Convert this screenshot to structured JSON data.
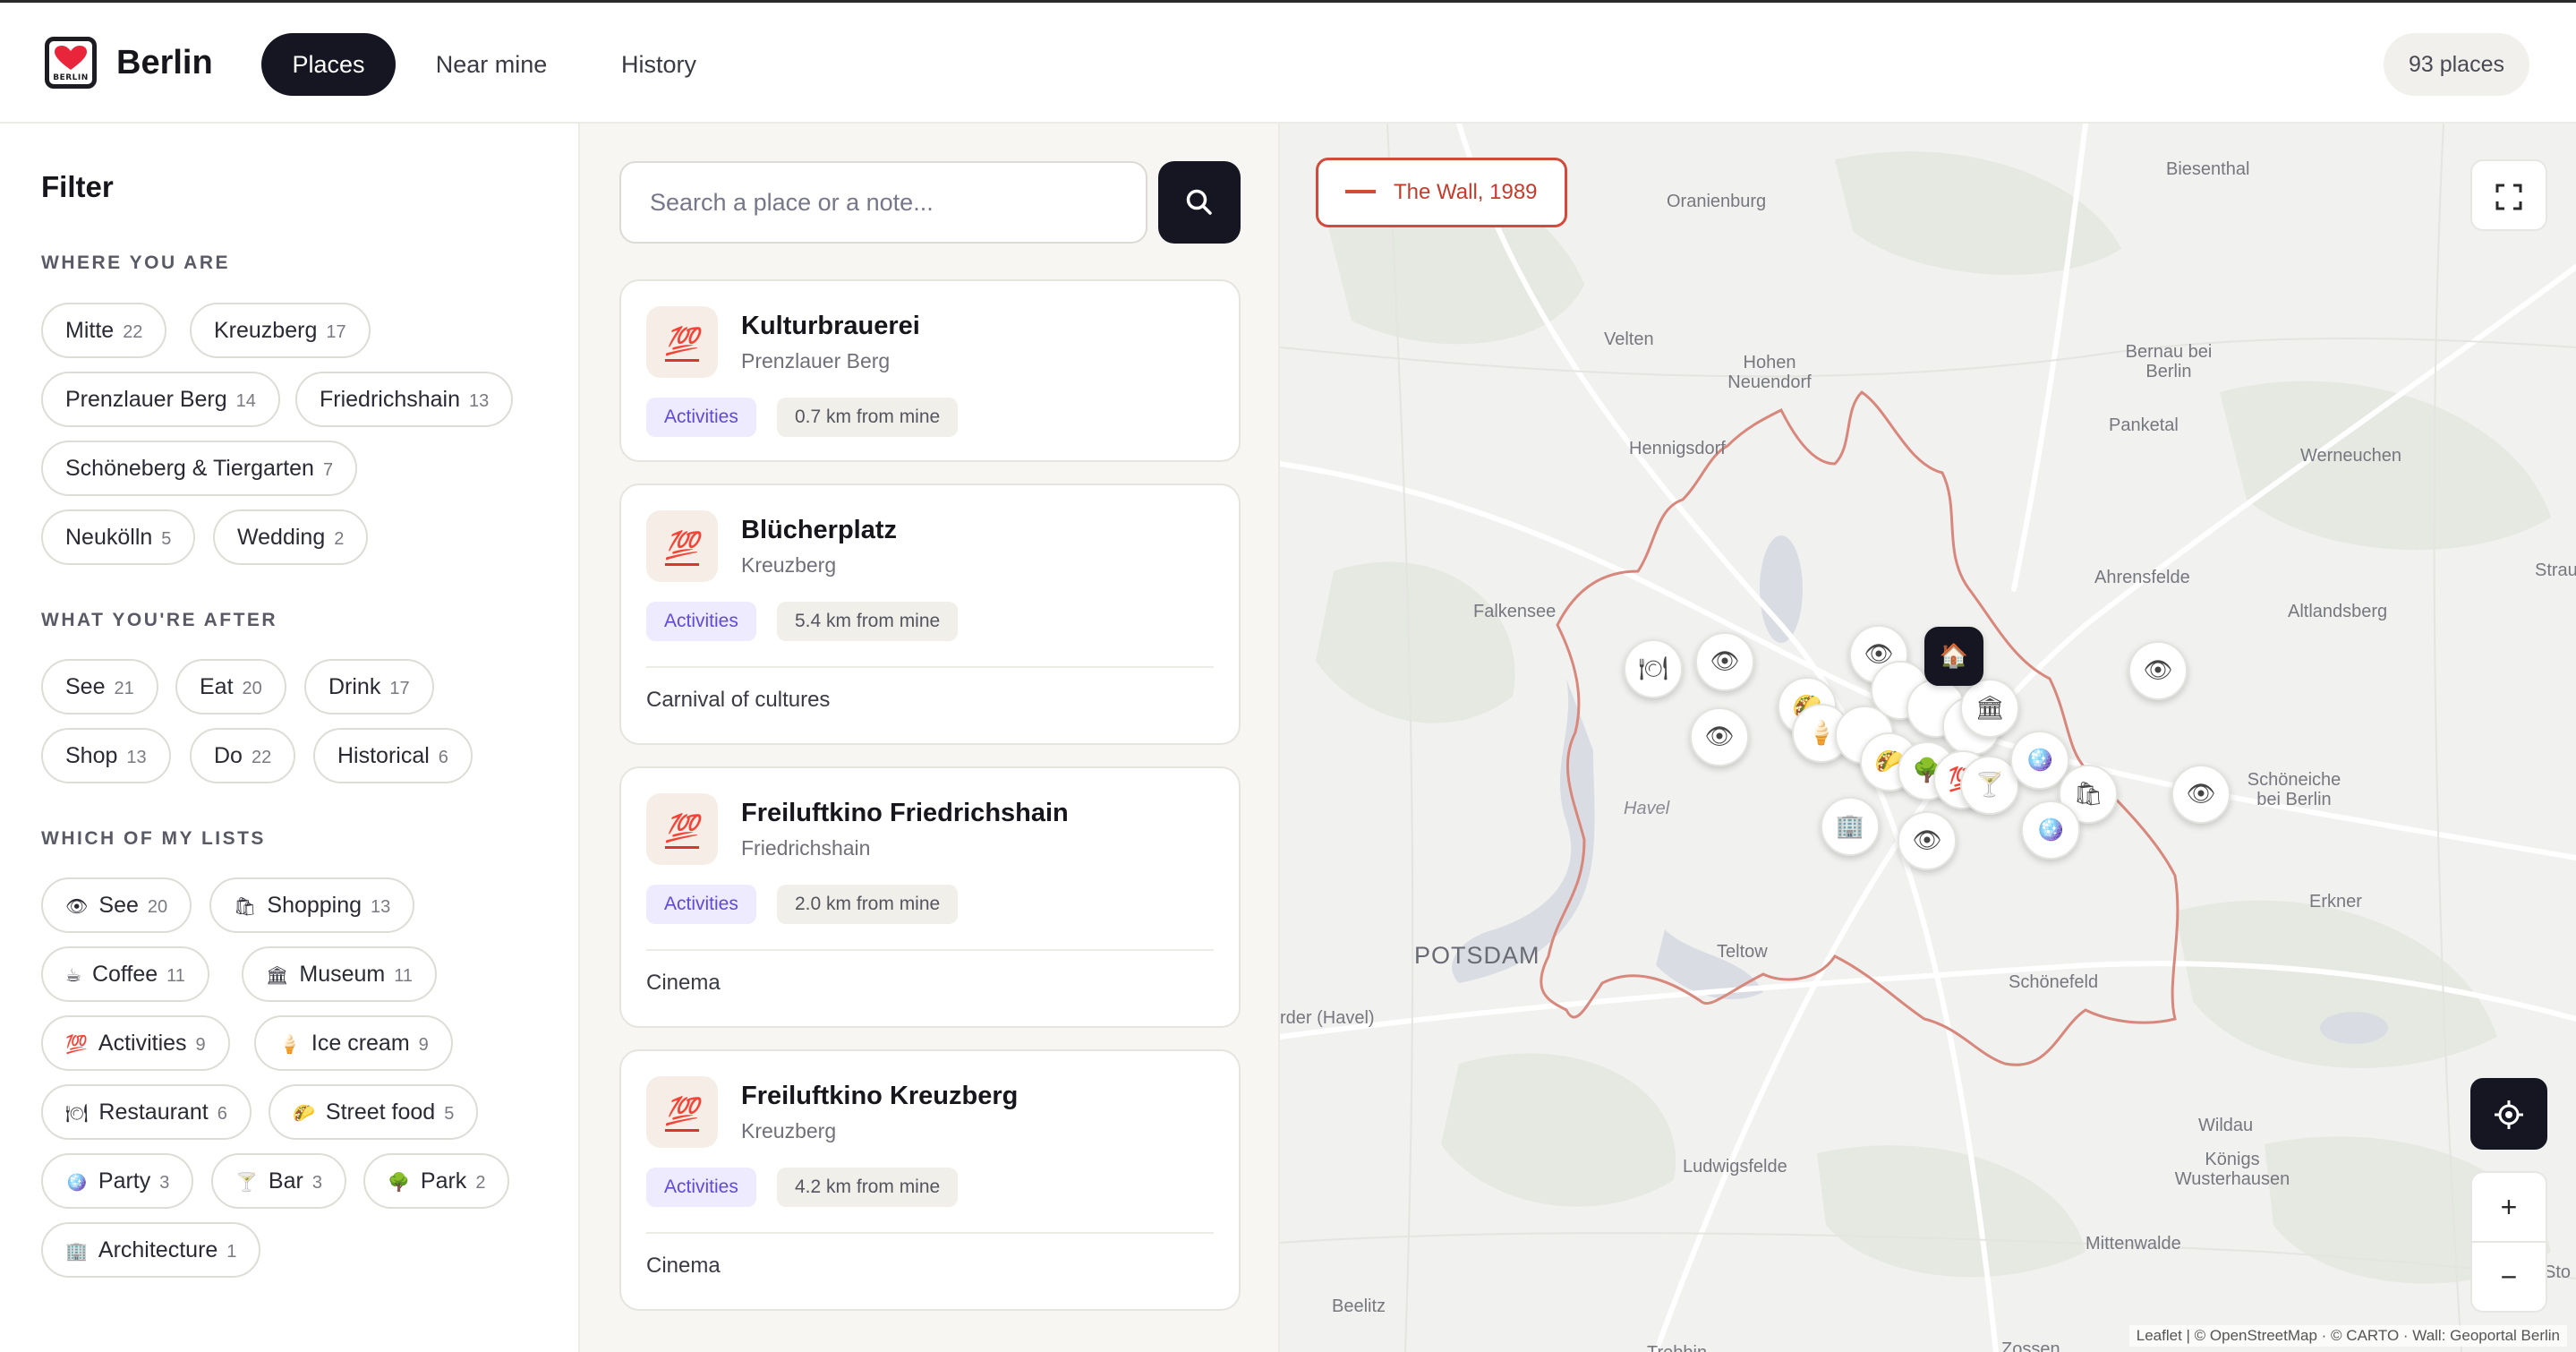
{
  "header": {
    "title": "Berlin",
    "logo_caption": "BERLIN",
    "tabs": [
      {
        "label": "Places",
        "active": true
      },
      {
        "label": "Near mine",
        "active": false
      },
      {
        "label": "History",
        "active": false
      }
    ],
    "count_badge": "93 places"
  },
  "filter": {
    "title": "Filter",
    "sections": [
      {
        "label": "WHERE YOU ARE",
        "chips": [
          {
            "label": "Mitte",
            "count": "22"
          },
          {
            "label": "Kreuzberg",
            "count": "17"
          },
          {
            "label": "Prenzlauer Berg",
            "count": "14"
          },
          {
            "label": "Friedrichshain",
            "count": "13"
          },
          {
            "label": "Schöneberg & Tiergarten",
            "count": "7"
          },
          {
            "label": "Neukölln",
            "count": "5"
          },
          {
            "label": "Wedding",
            "count": "2"
          }
        ]
      },
      {
        "label": "WHAT YOU'RE AFTER",
        "chips": [
          {
            "label": "See",
            "count": "21"
          },
          {
            "label": "Eat",
            "count": "20"
          },
          {
            "label": "Drink",
            "count": "17"
          },
          {
            "label": "Shop",
            "count": "13"
          },
          {
            "label": "Do",
            "count": "22"
          },
          {
            "label": "Historical",
            "count": "6"
          }
        ]
      },
      {
        "label": "WHICH OF MY LISTS",
        "chips": [
          {
            "label": "See",
            "count": "20",
            "icon": "👁"
          },
          {
            "label": "Shopping",
            "count": "13",
            "icon": "🛍"
          },
          {
            "label": "Coffee",
            "count": "11",
            "icon": "☕"
          },
          {
            "label": "Museum",
            "count": "11",
            "icon": "🏛"
          },
          {
            "label": "Activities",
            "count": "9",
            "icon": "💯"
          },
          {
            "label": "Ice cream",
            "count": "9",
            "icon": "🍦"
          },
          {
            "label": "Restaurant",
            "count": "6",
            "icon": "🍽"
          },
          {
            "label": "Street food",
            "count": "5",
            "icon": "🌮"
          },
          {
            "label": "Party",
            "count": "3",
            "icon": "🪩"
          },
          {
            "label": "Bar",
            "count": "3",
            "icon": "🍸"
          },
          {
            "label": "Park",
            "count": "2",
            "icon": "🌳"
          },
          {
            "label": "Architecture",
            "count": "1",
            "icon": "🏢"
          }
        ]
      }
    ]
  },
  "search": {
    "placeholder": "Search a place or a note..."
  },
  "places": [
    {
      "name": "Kulturbrauerei",
      "district": "Prenzlauer Berg",
      "category": "Activities",
      "distance": "0.7 km from mine",
      "note": "",
      "icon": "💯"
    },
    {
      "name": "Blücherplatz",
      "district": "Kreuzberg",
      "category": "Activities",
      "distance": "5.4 km from mine",
      "note": "Carnival of cultures",
      "icon": "💯"
    },
    {
      "name": "Freiluftkino Friedrichshain",
      "district": "Friedrichshain",
      "category": "Activities",
      "distance": "2.0 km from mine",
      "note": "Cinema",
      "icon": "💯"
    },
    {
      "name": "Freiluftkino Kreuzberg",
      "district": "Kreuzberg",
      "category": "Activities",
      "distance": "4.2 km from mine",
      "note": "Cinema",
      "icon": "💯"
    }
  ],
  "map": {
    "wall_toggle": "The Wall, 1989",
    "wall_color": "#d24a3a",
    "attribution": "Leaflet | © OpenStreetMap · © CARTO · Wall: Geoportal Berlin",
    "labels": [
      "Biesenthal",
      "Oranienburg",
      "Velten",
      "Hohen Neuendorf",
      "Bernau bei Berlin",
      "Hennigsdorf",
      "Panketal",
      "Werneuchen",
      "Falkensee",
      "Ahrensfelde",
      "Altlandsberg",
      "Strausb",
      "Schöneiche bei Berlin",
      "Havel",
      "Erkner",
      "POTSDAM",
      "Teltow",
      "Schönefeld",
      "rder (Havel)",
      "Wildau",
      "Königs Wusterhausen",
      "Ludwigsfelde",
      "Mittenwalde",
      "Beelitz",
      "Sto",
      "Zossen",
      "Trebbin"
    ],
    "controls": {
      "fullscreen": "fullscreen-icon",
      "locate": "locate-icon",
      "zoom_in": "+",
      "zoom_out": "−"
    }
  },
  "colors": {
    "accent_dark": "#161622",
    "activities_badge": "#5f4bd6",
    "wall_line": "#d24a3a"
  }
}
